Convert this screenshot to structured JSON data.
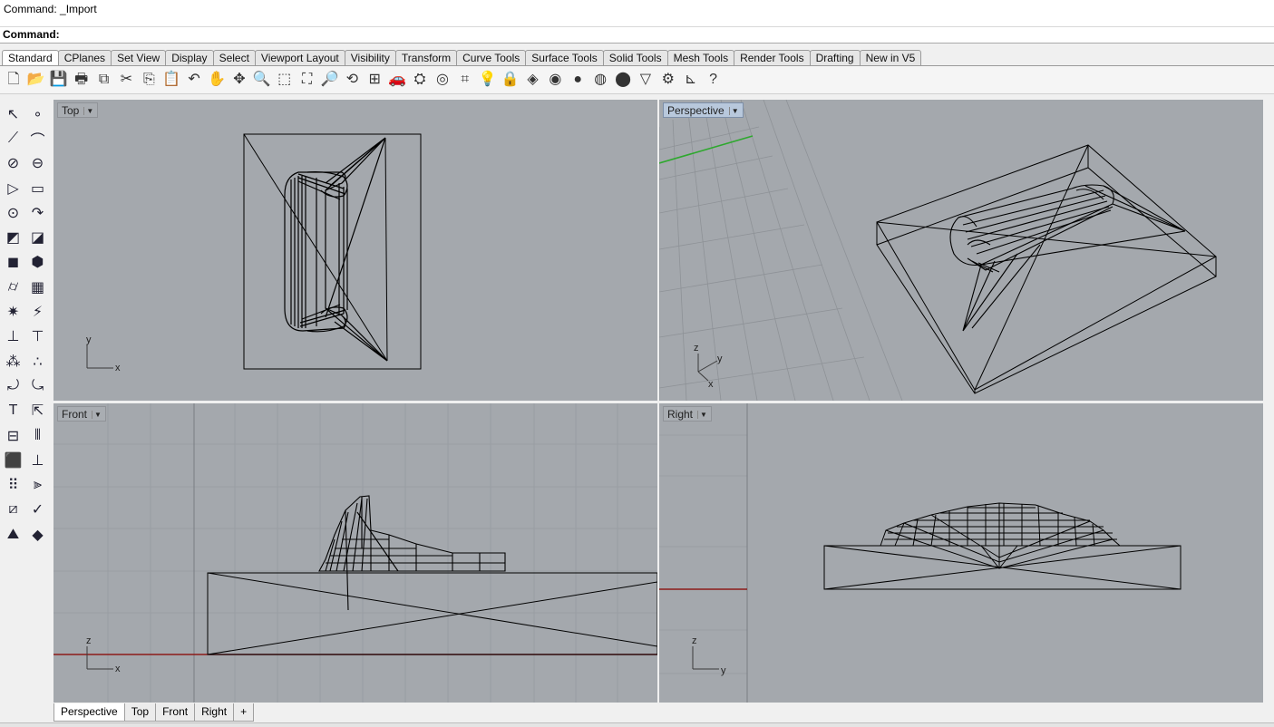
{
  "command": {
    "history_text": "Command: _Import",
    "prompt_label": "Command:",
    "input_value": ""
  },
  "tabs": [
    {
      "label": "Standard",
      "active": true
    },
    {
      "label": "CPlanes"
    },
    {
      "label": "Set View"
    },
    {
      "label": "Display"
    },
    {
      "label": "Select"
    },
    {
      "label": "Viewport Layout"
    },
    {
      "label": "Visibility"
    },
    {
      "label": "Transform"
    },
    {
      "label": "Curve Tools"
    },
    {
      "label": "Surface Tools"
    },
    {
      "label": "Solid Tools"
    },
    {
      "label": "Mesh Tools"
    },
    {
      "label": "Render Tools"
    },
    {
      "label": "Drafting"
    },
    {
      "label": "New in V5"
    }
  ],
  "toolbar_icons": [
    {
      "name": "new-file-icon",
      "glyph": "🗋"
    },
    {
      "name": "open-folder-icon",
      "glyph": "📂"
    },
    {
      "name": "save-icon",
      "glyph": "💾"
    },
    {
      "name": "print-icon",
      "glyph": "🖶"
    },
    {
      "name": "export-icon",
      "glyph": "⧉"
    },
    {
      "name": "cut-icon",
      "glyph": "✂"
    },
    {
      "name": "copy-icon",
      "glyph": "⎘"
    },
    {
      "name": "paste-icon",
      "glyph": "📋"
    },
    {
      "name": "undo-icon",
      "glyph": "↶"
    },
    {
      "name": "pan-hand-icon",
      "glyph": "✋"
    },
    {
      "name": "rotate-view-icon",
      "glyph": "✥"
    },
    {
      "name": "zoom-icon",
      "glyph": "🔍"
    },
    {
      "name": "zoom-window-icon",
      "glyph": "⬚"
    },
    {
      "name": "zoom-extents-icon",
      "glyph": "⛶"
    },
    {
      "name": "zoom-selected-icon",
      "glyph": "🔎"
    },
    {
      "name": "undo-view-icon",
      "glyph": "⟲"
    },
    {
      "name": "four-viewports-icon",
      "glyph": "⊞"
    },
    {
      "name": "car-icon",
      "glyph": "🚗"
    },
    {
      "name": "render-preview-icon",
      "glyph": "⛭"
    },
    {
      "name": "named-views-icon",
      "glyph": "◎"
    },
    {
      "name": "snap-icon",
      "glyph": "⌗"
    },
    {
      "name": "light-bulb-icon",
      "glyph": "💡"
    },
    {
      "name": "lock-icon",
      "glyph": "🔒"
    },
    {
      "name": "layers-icon",
      "glyph": "◈"
    },
    {
      "name": "color-wheel-icon",
      "glyph": "◉"
    },
    {
      "name": "material-sphere-icon",
      "glyph": "●"
    },
    {
      "name": "render-sphere-icon",
      "glyph": "◍"
    },
    {
      "name": "rendered-blue-sphere-icon",
      "glyph": "⬤"
    },
    {
      "name": "light-cone-icon",
      "glyph": "▽"
    },
    {
      "name": "options-gear-icon",
      "glyph": "⚙"
    },
    {
      "name": "dimension-icon",
      "glyph": "⊾"
    },
    {
      "name": "help-icon",
      "glyph": "?"
    }
  ],
  "left_tools": [
    {
      "name": "select-arrow-icon",
      "glyph": "↖"
    },
    {
      "name": "point-icon",
      "glyph": "∘"
    },
    {
      "name": "polyline-icon",
      "glyph": "⟋"
    },
    {
      "name": "curve-icon",
      "glyph": "⌒"
    },
    {
      "name": "circle-icon",
      "glyph": "⊘"
    },
    {
      "name": "ellipse-icon",
      "glyph": "⊖"
    },
    {
      "name": "polygon-icon",
      "glyph": "▷"
    },
    {
      "name": "rectangle-icon",
      "glyph": "▭"
    },
    {
      "name": "arc-icon",
      "glyph": "⊙"
    },
    {
      "name": "fillet-curve-icon",
      "glyph": "↷"
    },
    {
      "name": "surface-from-points-icon",
      "glyph": "◩"
    },
    {
      "name": "extrude-surface-icon",
      "glyph": "◪"
    },
    {
      "name": "box-icon",
      "glyph": "◼"
    },
    {
      "name": "boolean-union-icon",
      "glyph": "⬢"
    },
    {
      "name": "cylinder-icon",
      "glyph": "⌭"
    },
    {
      "name": "mesh-icon",
      "glyph": "▦"
    },
    {
      "name": "gumball-gear-icon",
      "glyph": "✷"
    },
    {
      "name": "flash-icon",
      "glyph": "⚡"
    },
    {
      "name": "trim-icon",
      "glyph": "⊥"
    },
    {
      "name": "split-icon",
      "glyph": "⊤"
    },
    {
      "name": "boolean-spheres-icon",
      "glyph": "⁂"
    },
    {
      "name": "explode-spheres-icon",
      "glyph": "∴"
    },
    {
      "name": "offset-curve-icon",
      "glyph": "⤾"
    },
    {
      "name": "fillet-edge-icon",
      "glyph": "⤿"
    },
    {
      "name": "text-icon",
      "glyph": "T"
    },
    {
      "name": "scale-icon",
      "glyph": "⇱"
    },
    {
      "name": "group-icon",
      "glyph": "⊟"
    },
    {
      "name": "mirror-icon",
      "glyph": "⫴"
    },
    {
      "name": "solid-box-icon",
      "glyph": "⬛"
    },
    {
      "name": "measure-icon",
      "glyph": "⊥"
    },
    {
      "name": "array-icon",
      "glyph": "⠿"
    },
    {
      "name": "analyze-icon",
      "glyph": "⫸"
    },
    {
      "name": "project-icon",
      "glyph": "⧄"
    },
    {
      "name": "check-icon",
      "glyph": "✓"
    },
    {
      "name": "shade-icon",
      "glyph": "⛰"
    },
    {
      "name": "rendered-display-icon",
      "glyph": "◆"
    }
  ],
  "viewports": {
    "top": {
      "label": "Top",
      "axis1": "y",
      "axis2": "x"
    },
    "perspective": {
      "label": "Perspective",
      "axis1": "z",
      "axis2": "y",
      "axis3": "x"
    },
    "front": {
      "label": "Front",
      "axis1": "z",
      "axis2": "x"
    },
    "right": {
      "label": "Right",
      "axis1": "z",
      "axis2": "y"
    }
  },
  "viewport_tabs": [
    {
      "label": "Perspective",
      "active": true
    },
    {
      "label": "Top"
    },
    {
      "label": "Front"
    },
    {
      "label": "Right"
    },
    {
      "label": "+"
    }
  ],
  "colors": {
    "viewport_bg": "#a4a8ad",
    "grid": "#989ca1",
    "x_axis": "#8b1a1a",
    "y_axis": "#2ea82e",
    "wire": "#000000",
    "active_label_bg": "#b8c8dc"
  }
}
